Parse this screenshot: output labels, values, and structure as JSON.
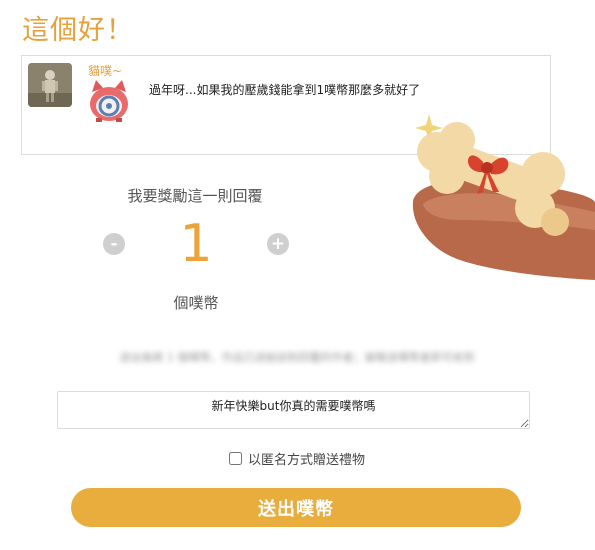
{
  "page_title": "這個好！",
  "reply": {
    "username": "貓噗~",
    "text": "過年呀...如果我的壓歲錢能拿到1噗幣那麼多就好了"
  },
  "reward": {
    "label": "我要獎勵這一則回覆",
    "amount": "1",
    "unit": "個噗幣",
    "minus_label": "-",
    "plus_label": "+"
  },
  "blurred_note": "送出後將 1 個噗幣，作品已送給該則回覆的作者；被贈送噗幣者即可收到",
  "message": {
    "value": "新年快樂but你真的需要噗幣嗎"
  },
  "anonymous": {
    "label": "以匿名方式贈送禮物",
    "checked": false
  },
  "send_button": {
    "label": "送出噗幣"
  },
  "colors": {
    "accent": "#e6a13c",
    "button": "#e8ad3d",
    "stepper": "#cfcfcf"
  },
  "icons": [
    "avatar-figure",
    "emoticon-cat",
    "bone-bow-sticker",
    "sparkle-icon"
  ]
}
